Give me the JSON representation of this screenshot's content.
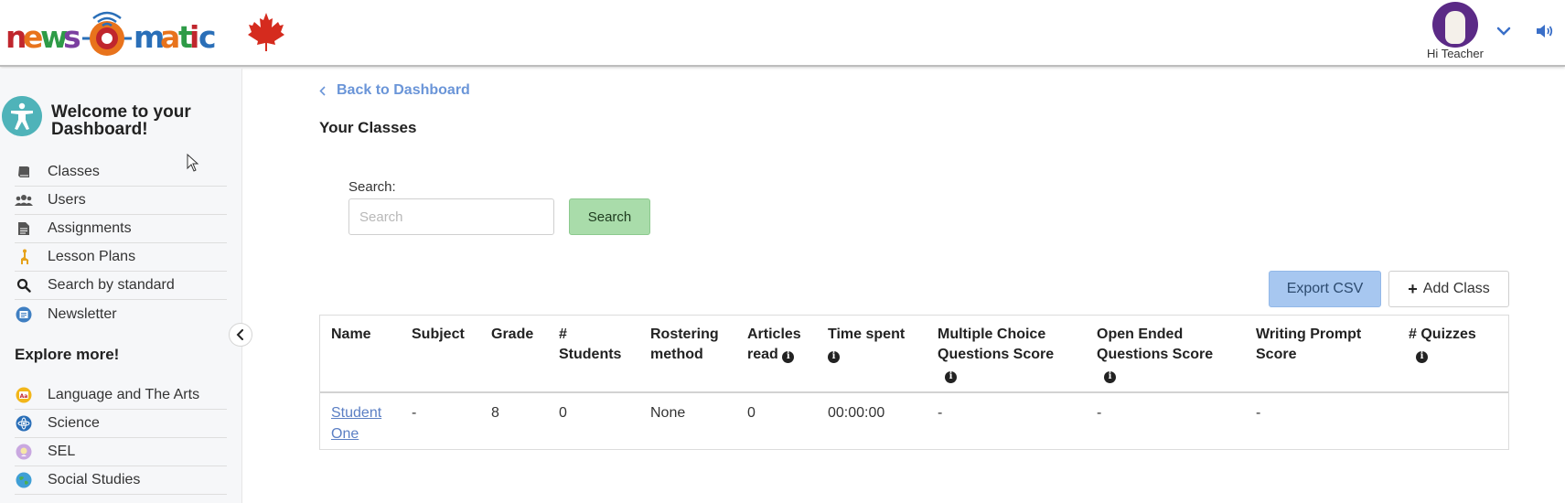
{
  "brand": {
    "logo_text": "newsomatic",
    "logo_colors": [
      "#c0262d",
      "#e8731c",
      "#f2b61a",
      "#2e9b47",
      "#2a6fb8",
      "#7b3fa0"
    ],
    "flag_color": "#d52b1e"
  },
  "user": {
    "greeting": "Hi Teacher",
    "avatar_bg": "#5b2a86"
  },
  "sidebar": {
    "welcome": "Welcome to your Dashboard!",
    "items": [
      {
        "label": "Classes",
        "icon": "book-icon"
      },
      {
        "label": "Users",
        "icon": "users-icon"
      },
      {
        "label": "Assignments",
        "icon": "document-icon"
      },
      {
        "label": "Lesson Plans",
        "icon": "giraffe-icon"
      },
      {
        "label": "Search by standard",
        "icon": "search-icon"
      },
      {
        "label": "Newsletter",
        "icon": "newsletter-icon"
      }
    ],
    "explore_heading": "Explore more!",
    "explore_items": [
      {
        "label": "Language and The Arts",
        "icon": "arts-icon"
      },
      {
        "label": "Science",
        "icon": "science-icon"
      },
      {
        "label": "SEL",
        "icon": "sel-icon"
      },
      {
        "label": "Social Studies",
        "icon": "globe-icon"
      }
    ]
  },
  "main": {
    "back_link": "Back to Dashboard",
    "page_title": "Your Classes",
    "search_label": "Search:",
    "search_placeholder": "Search",
    "search_value": "",
    "search_button": "Search",
    "export_button": "Export CSV",
    "add_button": "Add Class",
    "accent_color": "#6a95d8"
  },
  "table": {
    "headers": {
      "name": "Name",
      "subject": "Subject",
      "grade": "Grade",
      "students_1": "#",
      "students_2": "Students",
      "roster_1": "Rostering",
      "roster_2": "method",
      "articles_1": "Articles",
      "articles_2": "read",
      "time": "Time spent",
      "mcq_1": "Multiple Choice",
      "mcq_2": "Questions Score",
      "oeq_1": "Open Ended",
      "oeq_2": "Questions Score",
      "wp_1": "Writing Prompt",
      "wp_2": "Score",
      "quizzes": "# Quizzes"
    },
    "rows": [
      {
        "name_1": "Student",
        "name_2": "One",
        "subject": "-",
        "grade": "8",
        "students": "0",
        "roster": "None",
        "articles": "0",
        "time": "00:00:00",
        "mcq": "-",
        "oeq": "-",
        "wp": "-",
        "quizzes": ""
      }
    ]
  }
}
